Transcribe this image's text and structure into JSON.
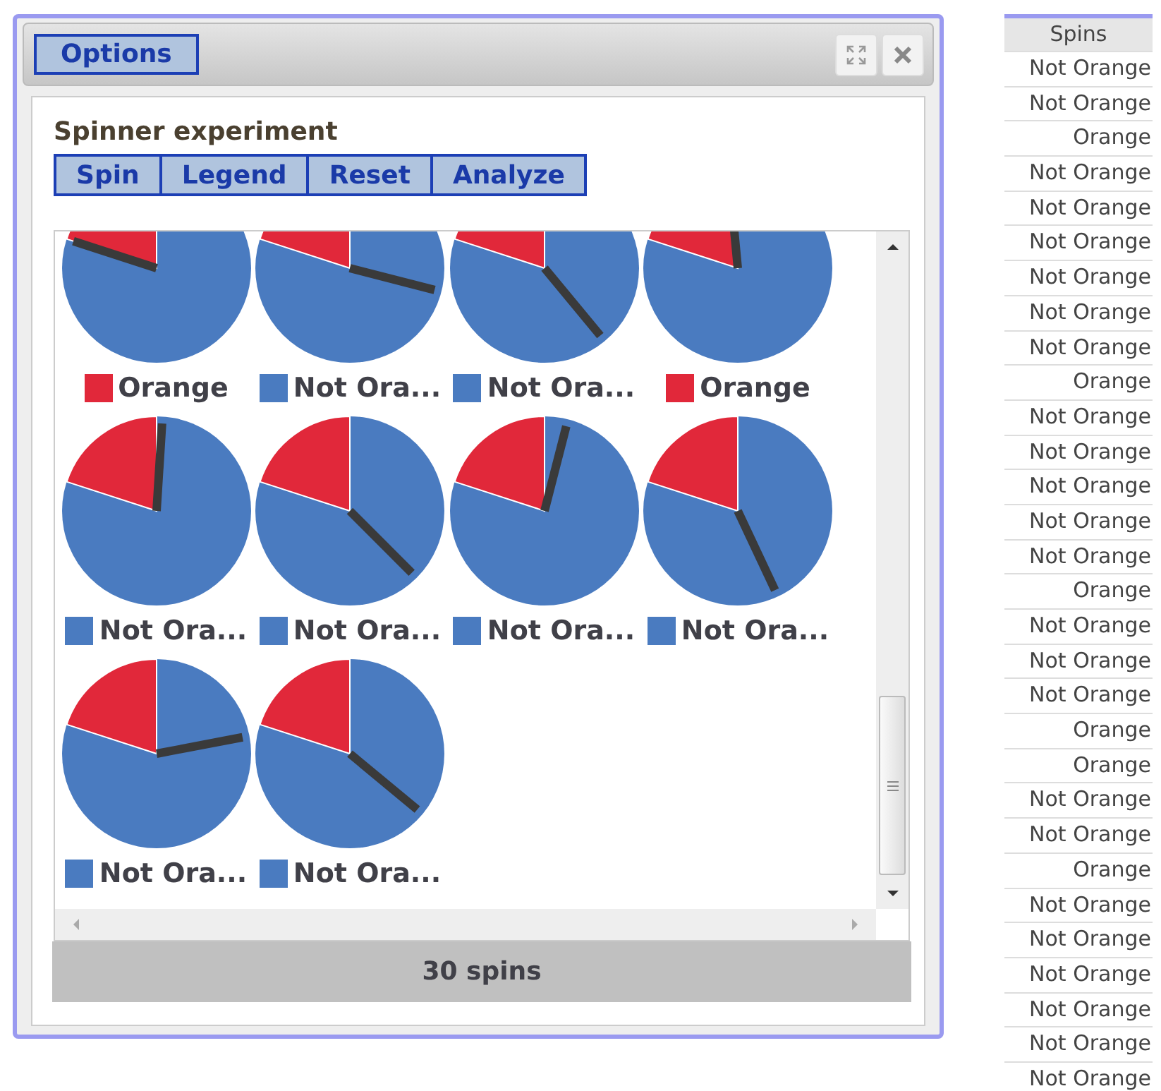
{
  "dialog": {
    "menu_button": "Options",
    "title": "Spinner experiment",
    "buttons": [
      "Spin",
      "Legend",
      "Reset",
      "Analyze"
    ],
    "spinners": [
      {
        "label": "Orange",
        "color": "#e1283a"
      },
      {
        "label": "Not Ora...",
        "color": "#4a7bc0"
      },
      {
        "label": "Not Ora...",
        "color": "#4a7bc0"
      },
      {
        "label": "Orange",
        "color": "#e1283a"
      },
      {
        "label": "Not Ora...",
        "color": "#4a7bc0"
      },
      {
        "label": "Not Ora...",
        "color": "#4a7bc0"
      },
      {
        "label": "Not Ora...",
        "color": "#4a7bc0"
      },
      {
        "label": "Not Ora...",
        "color": "#4a7bc0"
      },
      {
        "label": "Not Ora...",
        "color": "#4a7bc0"
      },
      {
        "label": "Not Ora...",
        "color": "#4a7bc0"
      }
    ],
    "footer": "30 spins"
  },
  "table": {
    "columns": [
      "Spins"
    ],
    "rows": [
      "Not Orange",
      "Not Orange",
      "Orange",
      "Not Orange",
      "Not Orange",
      "Not Orange",
      "Not Orange",
      "Not Orange",
      "Not Orange",
      "Orange",
      "Not Orange",
      "Not Orange",
      "Not Orange",
      "Not Orange",
      "Not Orange",
      "Orange",
      "Not Orange",
      "Not Orange",
      "Not Orange",
      "Orange",
      "Orange",
      "Not Orange",
      "Not Orange",
      "Orange",
      "Not Orange",
      "Not Orange",
      "Not Orange",
      "Not Orange",
      "Not Orange",
      "Not Orange"
    ]
  }
}
